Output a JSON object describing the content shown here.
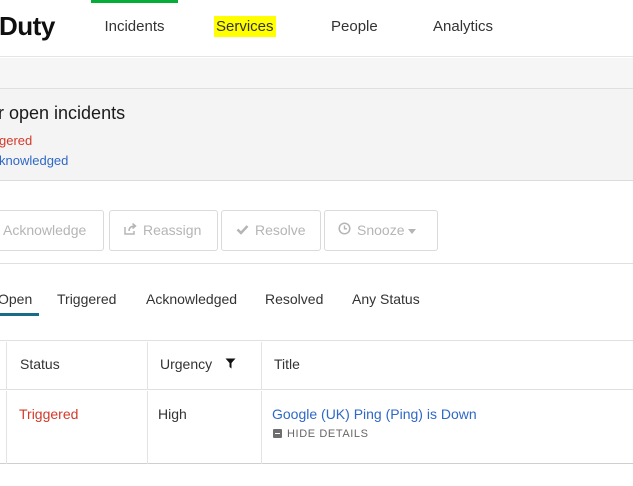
{
  "nav": {
    "logo": "Duty",
    "items": [
      {
        "label": "Incidents"
      },
      {
        "label": "Services"
      },
      {
        "label": "People"
      },
      {
        "label": "Analytics"
      }
    ],
    "active": "Incidents",
    "highlighted": "Services"
  },
  "summary": {
    "title": "r open incidents",
    "triggered_link": "gered",
    "acknowledged_link": "knowledged"
  },
  "toolbar": {
    "acknowledge": "Acknowledge",
    "reassign": "Reassign",
    "resolve": "Resolve",
    "snooze": "Snooze"
  },
  "tabs": [
    {
      "label": "Open"
    },
    {
      "label": "Triggered"
    },
    {
      "label": "Acknowledged"
    },
    {
      "label": "Resolved"
    },
    {
      "label": "Any Status"
    }
  ],
  "table": {
    "headers": {
      "status": "Status",
      "urgency": "Urgency",
      "title": "Title"
    },
    "rows": [
      {
        "status": "Triggered",
        "urgency": "High",
        "title": "Google (UK) Ping (Ping) is Down",
        "details_toggle": "HIDE DETAILS"
      }
    ]
  },
  "icons": {
    "reassign": "share-arrow-icon",
    "resolve": "check-icon",
    "snooze": "clock-icon",
    "urgency_filter": "funnel-icon"
  },
  "colors": {
    "active_nav": "#06ac38",
    "triggered": "#d33a2a",
    "link": "#2f68c6",
    "highlight": "#ffff00",
    "active_tab": "#1a6a8a"
  }
}
